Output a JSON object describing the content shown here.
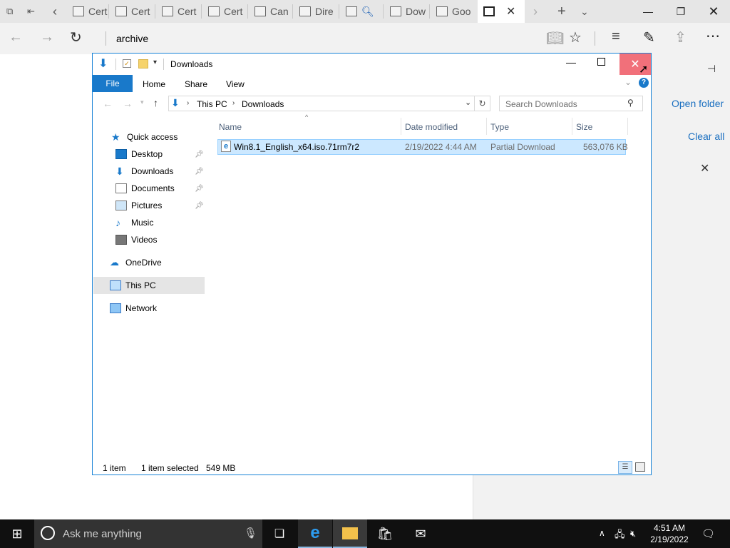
{
  "browser": {
    "tabs": [
      {
        "label": "Cert"
      },
      {
        "label": "Cert"
      },
      {
        "label": "Cert"
      },
      {
        "label": "Cert"
      },
      {
        "label": "Can"
      },
      {
        "label": "Dire"
      },
      {
        "label": ""
      },
      {
        "label": "Dow"
      },
      {
        "label": "Goo"
      }
    ],
    "address_text": "archive"
  },
  "hub": {
    "open_folder": "Open folder",
    "clear_all": "Clear all"
  },
  "explorer": {
    "title": "Downloads",
    "ribbon_tabs": {
      "file": "File",
      "home": "Home",
      "share": "Share",
      "view": "View"
    },
    "breadcrumb": {
      "root": "This PC",
      "current": "Downloads"
    },
    "search_placeholder": "Search Downloads",
    "nav": {
      "quick_access": "Quick access",
      "desktop": "Desktop",
      "downloads": "Downloads",
      "documents": "Documents",
      "pictures": "Pictures",
      "music": "Music",
      "videos": "Videos",
      "onedrive": "OneDrive",
      "thispc": "This PC",
      "network": "Network"
    },
    "columns": {
      "name": "Name",
      "date": "Date modified",
      "type": "Type",
      "size": "Size"
    },
    "files": [
      {
        "name": "Win8.1_English_x64.iso.71rm7r2",
        "date": "2/19/2022 4:44 AM",
        "type": "Partial Download",
        "size": "563,076 KB"
      }
    ],
    "status": {
      "count": "1 item",
      "selected": "1 item selected",
      "size": "549 MB"
    }
  },
  "taskbar": {
    "search_placeholder": "Ask me anything",
    "time": "4:51 AM",
    "date": "2/19/2022"
  },
  "colors": {
    "accent": "#1979ca",
    "selection": "#cce8ff",
    "close_hover": "#e81123"
  }
}
